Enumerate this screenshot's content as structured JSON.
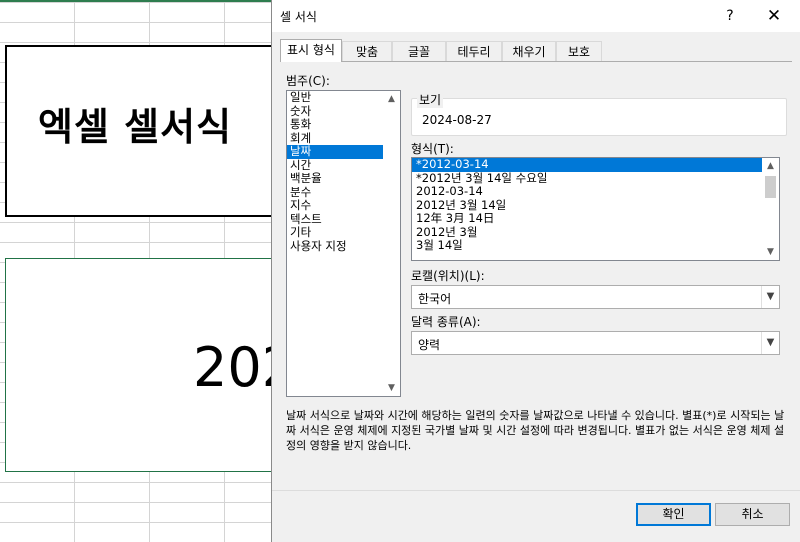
{
  "sheet": {
    "title_text": "엑셀 셀서식",
    "value_text": "202"
  },
  "dialog": {
    "title": "셀 서식",
    "help": "?",
    "close": "✕",
    "tabs": [
      "표시 형식",
      "맞춤",
      "글꼴",
      "테두리",
      "채우기",
      "보호"
    ],
    "category_label": "범주(C):",
    "categories": [
      "일반",
      "숫자",
      "통화",
      "회계",
      "날짜",
      "시간",
      "백분율",
      "분수",
      "지수",
      "텍스트",
      "기타",
      "사용자 지정"
    ],
    "selected_category": "날짜",
    "sample_label": "보기",
    "sample_value": "2024-08-27",
    "type_label": "형식(T):",
    "types": [
      "*2012-03-14",
      "*2012년 3월 14일 수요일",
      "2012-03-14",
      "2012년 3월 14일",
      "12年 3月 14日",
      "2012년 3월",
      "3월 14일"
    ],
    "selected_type": "*2012-03-14",
    "locale_label": "로캘(위치)(L):",
    "locale_value": "한국어",
    "calendar_label": "달력 종류(A):",
    "calendar_value": "양력",
    "description": "날짜 서식으로 날짜와 시간에 해당하는 일련의 숫자를 날짜값으로 나타낼 수 있습니다. 별표(*)로 시작되는 날짜 서식은 운영 체제에 지정된 국가별 날짜 및 시간 설정에 따라 변경됩니다. 별표가 없는 서식은 운영 체제 설정의 영향을 받지 않습니다.",
    "ok_label": "확인",
    "cancel_label": "취소"
  },
  "colors": {
    "selection": "#0078d7",
    "excel_green": "#217346"
  }
}
